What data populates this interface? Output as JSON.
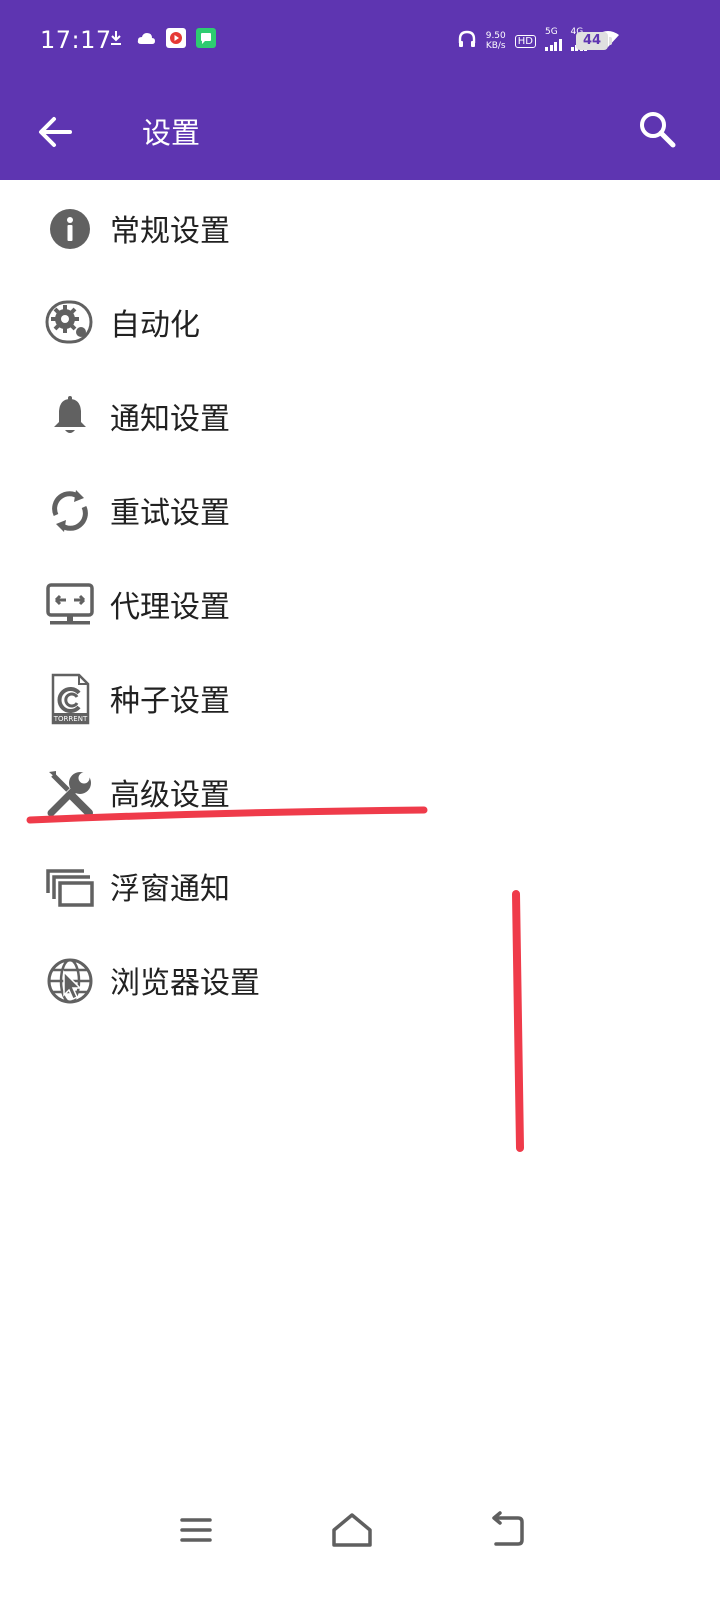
{
  "status_bar": {
    "time": "17:17",
    "speed_value": "9.50",
    "speed_unit": "KB/s",
    "hd_label": "HD",
    "sim1_label": "5G",
    "sim2_label": "4G",
    "battery": "44",
    "icons": [
      "download-icon",
      "cloud-icon",
      "video-app-icon",
      "chat-app-icon",
      "headphones-icon",
      "wifi-icon"
    ]
  },
  "app_bar": {
    "title": "设置",
    "background_color": "#5e35b1",
    "back_icon": "arrow-left-icon",
    "search_icon": "search-icon"
  },
  "settings": [
    {
      "label": "常规设置",
      "icon": "info-icon"
    },
    {
      "label": "自动化",
      "icon": "automation-gear-icon"
    },
    {
      "label": "通知设置",
      "icon": "bell-icon"
    },
    {
      "label": "重试设置",
      "icon": "retry-icon"
    },
    {
      "label": "代理设置",
      "icon": "proxy-monitor-icon"
    },
    {
      "label": "种子设置",
      "icon": "torrent-file-icon",
      "icon_text": "TORRENT"
    },
    {
      "label": "高级设置",
      "icon": "wrench-screwdriver-icon"
    },
    {
      "label": "浮窗通知",
      "icon": "floating-windows-icon"
    },
    {
      "label": "浏览器设置",
      "icon": "globe-cursor-icon"
    }
  ],
  "nav_bar": {
    "icons": [
      "menu-icon",
      "home-icon",
      "back-nav-icon"
    ]
  },
  "annotation_color": "#ef3b4a"
}
